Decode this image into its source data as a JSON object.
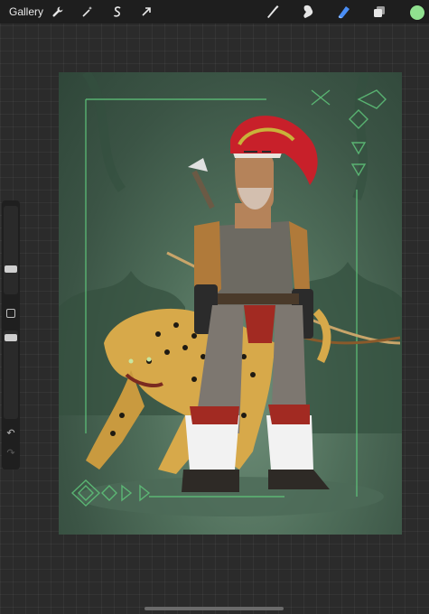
{
  "topbar": {
    "gallery_label": "Gallery",
    "left_tools": [
      {
        "icon": "wrench-icon",
        "name": "actions"
      },
      {
        "icon": "magic-wand-icon",
        "name": "adjustments"
      },
      {
        "icon": "selection-s-icon",
        "name": "selection"
      },
      {
        "icon": "arrow-cursor-icon",
        "name": "transform"
      }
    ],
    "right_tools": [
      {
        "icon": "brush-icon",
        "name": "brush"
      },
      {
        "icon": "smudge-icon",
        "name": "smudge"
      },
      {
        "icon": "eraser-icon",
        "name": "eraser",
        "active": true
      },
      {
        "icon": "layers-icon",
        "name": "layers"
      }
    ],
    "current_color": "#90e08f",
    "active_tool_color": "#4a8ef5"
  },
  "sidebar": {
    "brush_size_slider": {
      "value": 0.3
    },
    "opacity_slider": {
      "value": 0.95
    }
  },
  "canvas": {
    "artwork": "jaguar-and-warrior-illustration",
    "background_color": "#3d5a47"
  }
}
